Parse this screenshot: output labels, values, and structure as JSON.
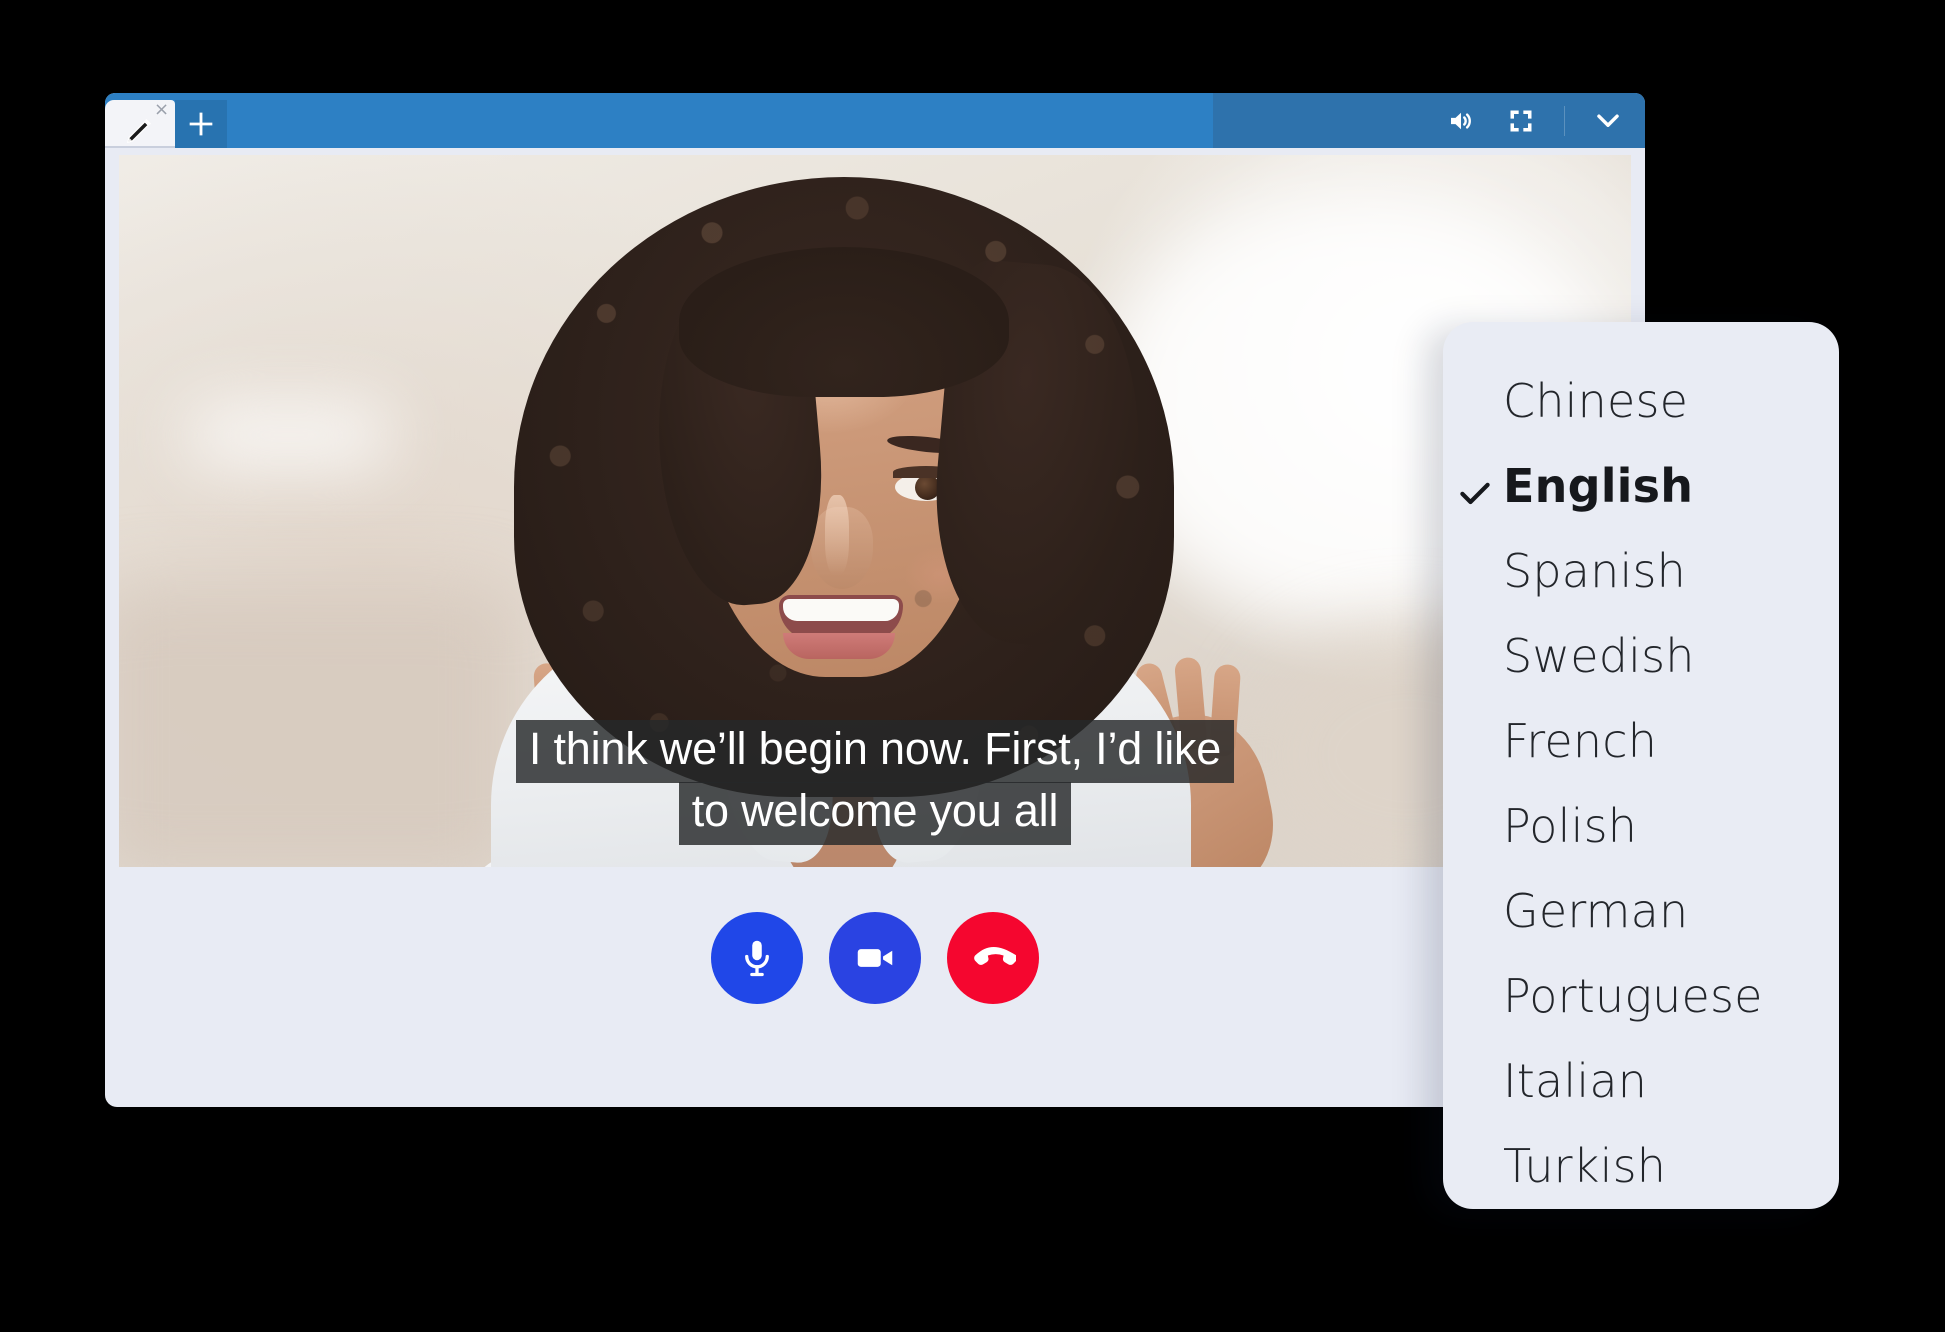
{
  "window": {
    "titlebar": {
      "tab": {
        "icon": "pencil-icon",
        "close_label": "×"
      },
      "new_tab_label": "+",
      "actions": [
        {
          "name": "volume-icon",
          "label": "Volume"
        },
        {
          "name": "fullscreen-icon",
          "label": "Fullscreen"
        },
        {
          "name": "chevron-down-icon",
          "label": "Minimize"
        }
      ],
      "accent_color": "#2d80c4",
      "accent_color_shaded": "#2e72ac"
    }
  },
  "video": {
    "captions": {
      "line1": "I think we’ll begin now. First, I’d like",
      "line2": "to welcome you all"
    }
  },
  "controls": {
    "mic": {
      "label": "Microphone",
      "color": "#2047e8"
    },
    "camera": {
      "label": "Camera",
      "color": "#2a43e2"
    },
    "end_call": {
      "label": "End call",
      "color": "#f5062f"
    }
  },
  "language_menu": {
    "background": "#e9ecf4",
    "selected": "English",
    "items": [
      {
        "label": "Chinese",
        "selected": false
      },
      {
        "label": "English",
        "selected": true
      },
      {
        "label": "Spanish",
        "selected": false
      },
      {
        "label": "Swedish",
        "selected": false
      },
      {
        "label": "French",
        "selected": false
      },
      {
        "label": "Polish",
        "selected": false
      },
      {
        "label": "German",
        "selected": false
      },
      {
        "label": "Portuguese",
        "selected": false
      },
      {
        "label": "Italian",
        "selected": false
      },
      {
        "label": "Turkish",
        "selected": false
      }
    ]
  }
}
